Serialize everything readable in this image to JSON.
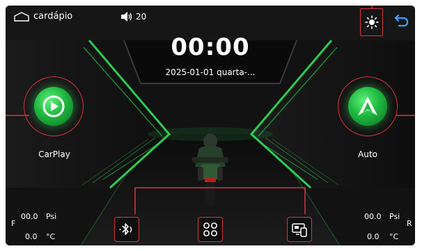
{
  "status_bar": {
    "home_label": "cardápio",
    "volume_level": "20"
  },
  "clock": {
    "time": "00:00",
    "date": "2025-01-01 quarta-..."
  },
  "apps": {
    "carplay_label": "CarPlay",
    "auto_label": "Auto"
  },
  "tire_pressure": {
    "front": {
      "side": "F",
      "pressure": "00.0",
      "pressure_unit": "Psi",
      "temperature": "0.0",
      "temperature_unit": "°C"
    },
    "rear": {
      "side": "R",
      "pressure": "00.0",
      "pressure_unit": "Psi",
      "temperature": "0.0",
      "temperature_unit": "°C"
    }
  },
  "dock": [
    "bluetooth-music-icon",
    "apps-grid-icon",
    "phone-mirroring-icon"
  ],
  "colors": {
    "background": "#121212",
    "accent_green": "#2ee05a",
    "highlight_red": "#e0323c",
    "back_arrow_blue": "#3aa0ff"
  }
}
